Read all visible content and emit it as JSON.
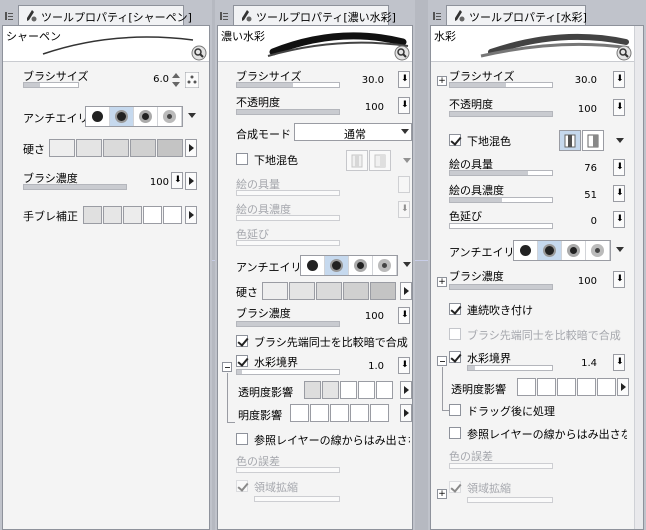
{
  "panels": [
    {
      "tab_title": "ツールプロパティ[シャーペン]",
      "brush_name": "シャーペン",
      "brush_size_label": "ブラシサイズ",
      "brush_size_value": "6.0",
      "antialias_label": "アンチエイリアス",
      "hardness_label": "硬さ",
      "density_label": "ブラシ濃度",
      "density_value": "100",
      "stabilizer_label": "手ブレ補正"
    },
    {
      "tab_title": "ツールプロパティ[濃い水彩]",
      "brush_name": "濃い水彩",
      "brush_size_label": "ブラシサイズ",
      "brush_size_value": "30.0",
      "opacity_label": "不透明度",
      "opacity_value": "100",
      "blend_mode_label": "合成モード",
      "blend_mode_value": "通常",
      "underlay_label": "下地混色",
      "paint_amount_label": "絵の具量",
      "paint_density_label": "絵の具濃度",
      "color_stretch_label": "色延び",
      "antialias_label": "アンチエイリアス",
      "hardness_label": "硬さ",
      "density_label": "ブラシ濃度",
      "density_value": "100",
      "compare_label": "ブラシ先端同士を比較暗で合成",
      "watercolor_edge_label": "水彩境界",
      "watercolor_edge_value": "1.0",
      "opacity_effect_label": "透明度影響",
      "brightness_effect_label": "明度影響",
      "ref_layer_label": "参照レイヤーの線からはみ出さない",
      "color_error_label": "色の誤差",
      "area_expand_label": "領域拡縮"
    },
    {
      "tab_title": "ツールプロパティ[水彩]",
      "brush_name": "水彩",
      "brush_size_label": "ブラシサイズ",
      "brush_size_value": "30.0",
      "opacity_label": "不透明度",
      "opacity_value": "100",
      "underlay_label": "下地混色",
      "paint_amount_label": "絵の具量",
      "paint_amount_value": "76",
      "paint_density_label": "絵の具濃度",
      "paint_density_value": "51",
      "color_stretch_label": "色延び",
      "color_stretch_value": "0",
      "antialias_label": "アンチエイリアス",
      "density_label": "ブラシ濃度",
      "density_value": "100",
      "continuous_label": "連続吹き付け",
      "compare_label": "ブラシ先端同士を比較暗で合成",
      "watercolor_edge_label": "水彩境界",
      "watercolor_edge_value": "1.4",
      "opacity_effect_label": "透明度影響",
      "drag_after_label": "ドラッグ後に処理",
      "ref_layer_label": "参照レイヤーの線からはみ出さない",
      "color_error_label": "色の誤差",
      "area_expand_label": "領域拡縮"
    }
  ]
}
